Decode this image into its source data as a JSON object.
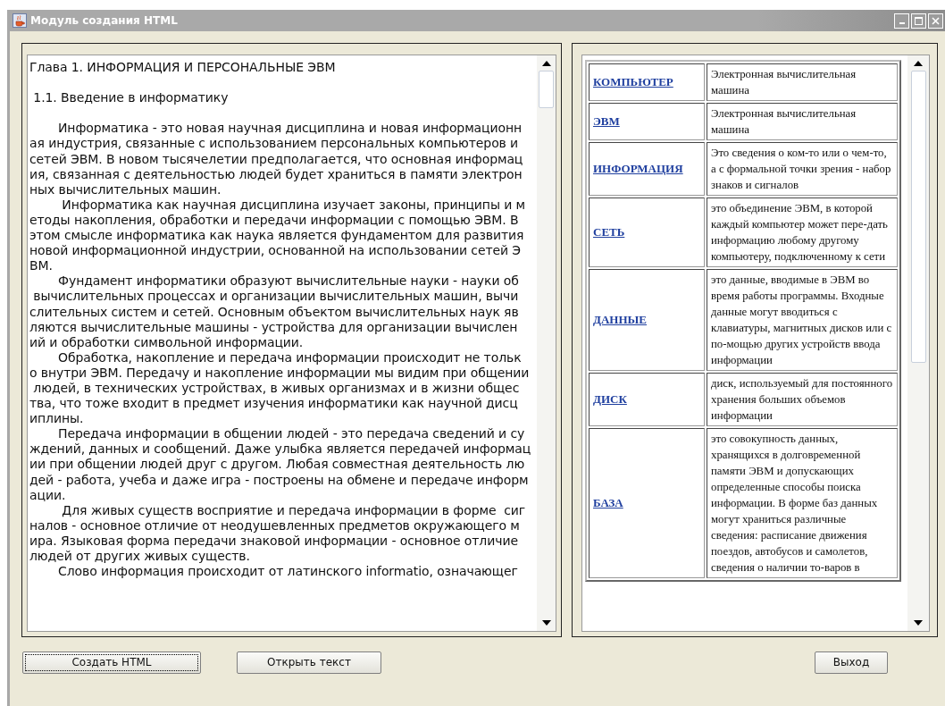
{
  "window": {
    "title": "Модуль создания HTML"
  },
  "text_area": {
    "lines": [
      {
        "text": "Глава 1. ИНФОРМАЦИЯ И ПЕРСОНАЛЬНЫЕ ЭВМ",
        "kind": "heading"
      },
      {
        "text": " 1.1. Введение в информатику",
        "kind": "heading"
      },
      {
        "text": "Информатика - это новая научная дисциплина и новая информационн",
        "indent": true
      },
      {
        "text": "ая индустрия, связанные с использованием персональных компьютеров и",
        "indent": false
      },
      {
        "text": "сетей ЭВМ. В новом тысячелетии предполагается, что основная информац",
        "indent": false
      },
      {
        "text": "ия, связанная с деятельностью людей будет храниться в памяти электрон",
        "indent": false
      },
      {
        "text": "ных вычислительных машин.",
        "indent": false
      },
      {
        "text": " Информатика как научная дисциплина изучает законы, принципы и м",
        "indent": true
      },
      {
        "text": "етоды накопления, обработки и передачи информации с помощью ЭВМ. В",
        "indent": false
      },
      {
        "text": "этом смысле информатика как наука является фундаментом для развития",
        "indent": false
      },
      {
        "text": "новой информационной индустрии, основанной на использовании сетей Э",
        "indent": false
      },
      {
        "text": "ВМ.",
        "indent": false
      },
      {
        "text": "Фундамент информатики образуют вычислительные науки - науки об",
        "indent": true
      },
      {
        "text": " вычислительных процессах и организации вычислительных машин, вычи",
        "indent": false
      },
      {
        "text": "слительных систем и сетей. Основным объектом вычислительных наук яв",
        "indent": false
      },
      {
        "text": "ляются вычислительные машины - устройства для организации вычислен",
        "indent": false
      },
      {
        "text": "ий и обработки символьной информации.",
        "indent": false
      },
      {
        "text": "Обработка, накопление и передача информации происходит не тольк",
        "indent": true
      },
      {
        "text": "о внутри ЭВМ. Передачу и накопление информации мы видим при общении",
        "indent": false
      },
      {
        "text": " людей, в технических устройствах, в живых организмах и в жизни общес",
        "indent": false
      },
      {
        "text": "тва, что тоже входит в предмет изучения информатики как научной дисц",
        "indent": false
      },
      {
        "text": "иплины.",
        "indent": false
      },
      {
        "text": "Передача информации в общении людей - это передача сведений и су",
        "indent": true
      },
      {
        "text": "ждений, данных и сообщений. Даже улыбка является передачей информац",
        "indent": false
      },
      {
        "text": "ии при общении людей друг с другом. Любая совместная деятельность лю",
        "indent": false
      },
      {
        "text": "дей - работа, учеба и даже игра - построены на обмене и передаче информ",
        "indent": false
      },
      {
        "text": "ации.",
        "indent": false
      },
      {
        "text": " Для живых существ восприятие и передача информации в форме  сиг",
        "indent": true
      },
      {
        "text": "налов - основное отличие от неодушевленных предметов окружающего м",
        "indent": false
      },
      {
        "text": "ира. Языковая форма передачи знаковой информации - основное отличие",
        "indent": false
      },
      {
        "text": "людей от других живых существ.",
        "indent": false
      },
      {
        "text": "Слово информация происходит от латинского informatio, означающег",
        "indent": true
      }
    ]
  },
  "glossary": {
    "rows": [
      {
        "term": "КОМПЬЮТЕР",
        "definition": "Электронная вычислительная машина"
      },
      {
        "term": "ЭВМ",
        "definition": "Электронная вычислительная машина"
      },
      {
        "term": "ИНФОРМАЦИЯ",
        "definition": "Это сведения о ком-то или о чем-то, а с формальной точки зрения - набор знаков и сигналов"
      },
      {
        "term": "СЕТЬ",
        "definition": "это объединение ЭВМ, в которой каждый компьютер может пере-дать информацию любому другому компьютеру, подключенному к сети"
      },
      {
        "term": "ДАННЫЕ",
        "definition": "это данные, вводимые в ЭВМ во время работы программы. Входные данные могут вводиться с клавиатуры, магнитных дисков или с по-мощью других устройств ввода информации"
      },
      {
        "term": "ДИСК",
        "definition": "диск, используемый для постоянного хранения больших объемов информации"
      },
      {
        "term": "БАЗА",
        "definition": "это совокупность данных, хранящихся в долговременной памяти ЭВМ и допускающих определенные способы поиска информации. В форме баз данных могут храниться различные сведения: расписание движения поездов, автобусов и самолетов, сведения о наличии то-варов в"
      }
    ]
  },
  "buttons": [
    {
      "label": "Создать HTML",
      "focused": true
    },
    {
      "label": "Открыть текст",
      "focused": false
    },
    {
      "label": "Выход",
      "focused": false
    }
  ]
}
